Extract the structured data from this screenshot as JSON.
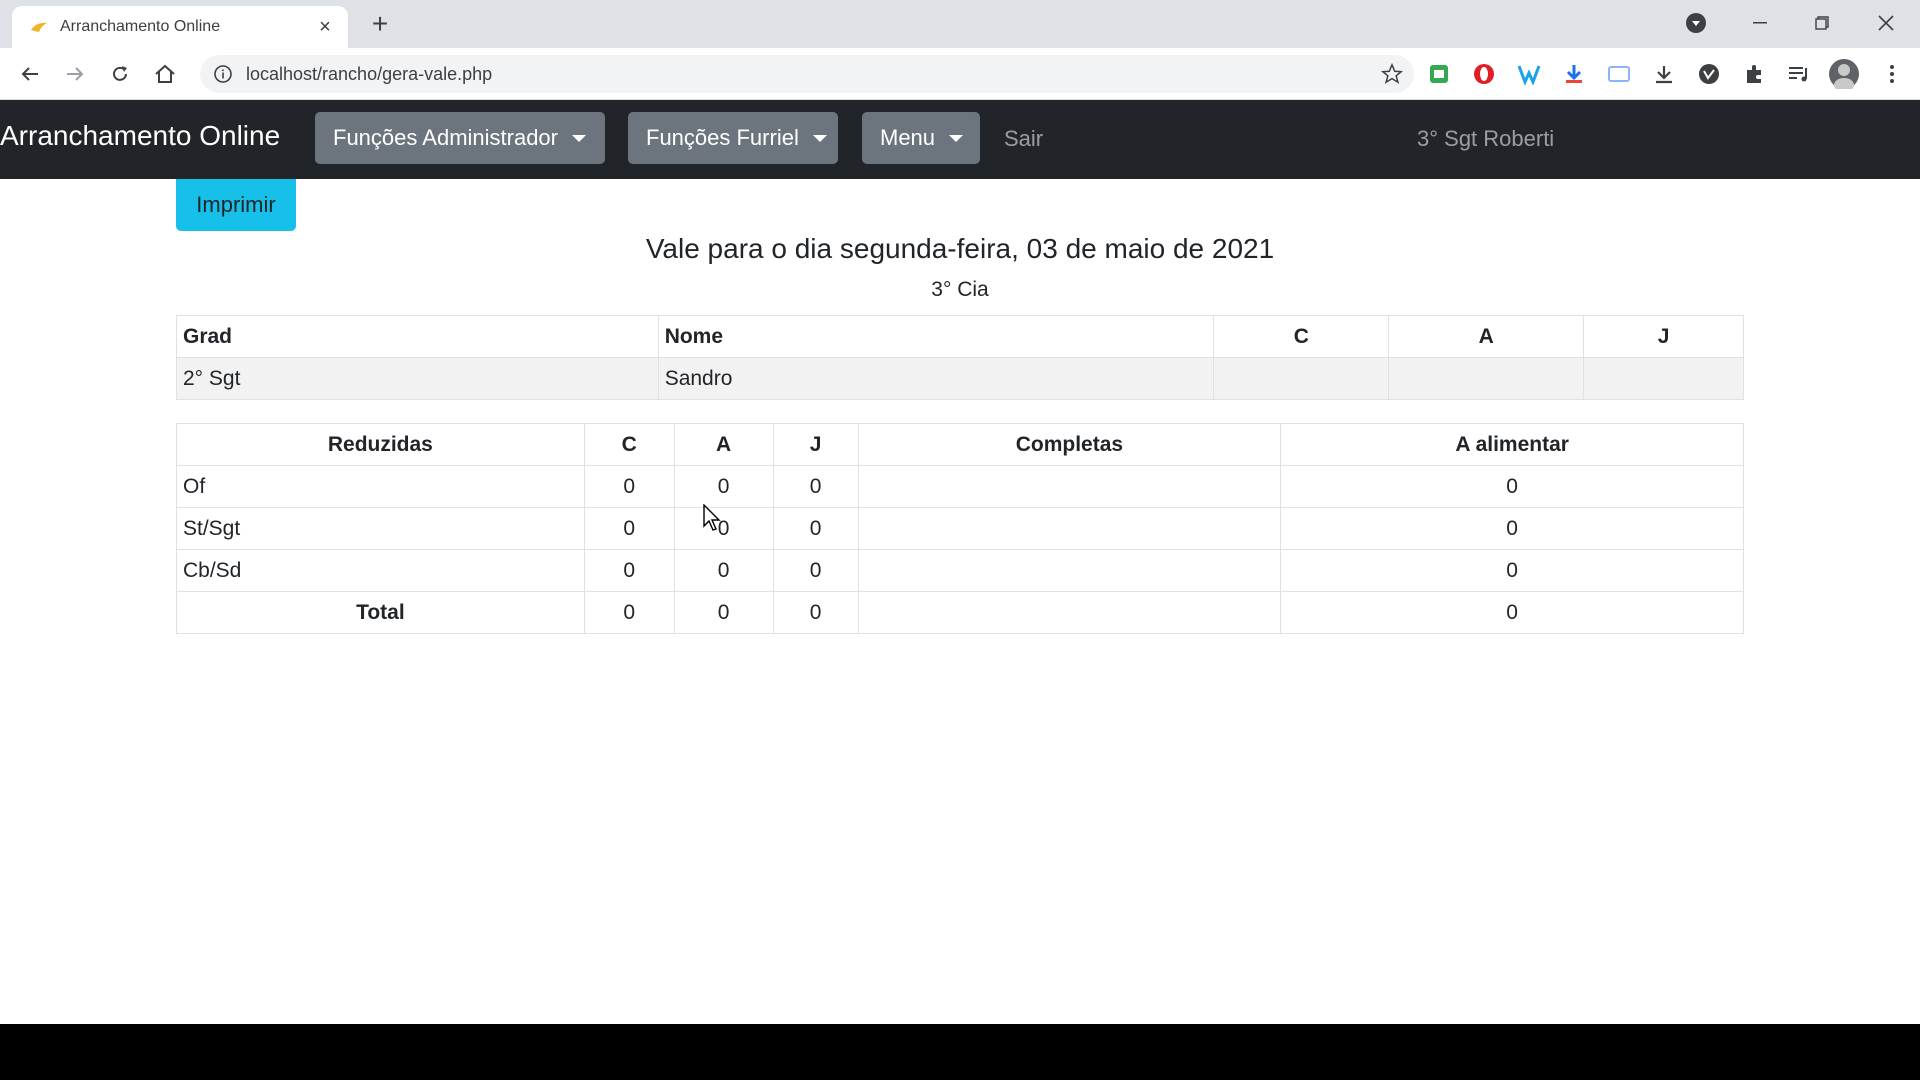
{
  "browser": {
    "tab_title": "Arranchamento Online",
    "url": "localhost/rancho/gera-vale.php"
  },
  "navbar": {
    "brand": "Arranchamento Online",
    "menus": [
      "Funções Administrador",
      "Funções Furriel",
      "Menu"
    ],
    "logout": "Sair",
    "user": "3° Sgt Roberti"
  },
  "main": {
    "print_button": "Imprimir",
    "title": "Vale para o dia segunda-feira, 03 de maio de 2021",
    "company": "3° Cia"
  },
  "roster_table": {
    "headers": [
      "Grad",
      "Nome",
      "C",
      "A",
      "J"
    ],
    "rows": [
      {
        "grad": "2° Sgt",
        "nome": "Sandro",
        "c": "",
        "a": "",
        "j": ""
      }
    ]
  },
  "summary_table": {
    "headers": [
      "Reduzidas",
      "C",
      "A",
      "J",
      "Completas",
      "A alimentar"
    ],
    "rows": [
      {
        "label": "Of",
        "c": "0",
        "a": "0",
        "j": "0",
        "completas": "",
        "alimentar": "0"
      },
      {
        "label": "St/Sgt",
        "c": "0",
        "a": "0",
        "j": "0",
        "completas": "",
        "alimentar": "0"
      },
      {
        "label": "Cb/Sd",
        "c": "0",
        "a": "0",
        "j": "0",
        "completas": "",
        "alimentar": "0"
      },
      {
        "label": "Total",
        "c": "0",
        "a": "0",
        "j": "0",
        "completas": "",
        "alimentar": "0"
      }
    ]
  },
  "icons": {
    "accent": "#17c0e8",
    "navbar_bg": "#212529",
    "dropdown_bg": "#6c757d"
  }
}
